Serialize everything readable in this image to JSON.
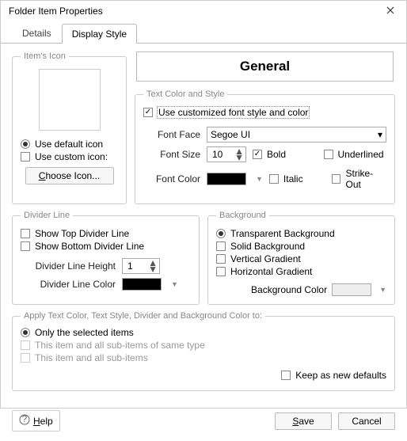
{
  "window": {
    "title": "Folder Item Properties"
  },
  "tabs": {
    "details": "Details",
    "display_style": "Display Style"
  },
  "icon_group": {
    "legend": "Item's Icon",
    "use_default": "Use default icon",
    "use_custom": "Use custom icon:",
    "choose_btn": "Choose Icon..."
  },
  "preview": {
    "text": "General"
  },
  "text_style": {
    "legend": "Text Color and Style",
    "use_custom": "Use customized font style and color",
    "font_face_lbl": "Font Face",
    "font_face_val": "Segoe UI",
    "font_size_lbl": "Font Size",
    "font_size_val": "10",
    "font_color_lbl": "Font Color",
    "bold": "Bold",
    "italic": "Italic",
    "underlined": "Underlined",
    "strikeout": "Strike-Out"
  },
  "divider": {
    "legend": "Divider Line",
    "show_top": "Show Top Divider Line",
    "show_bottom": "Show Bottom Divider Line",
    "height_lbl": "Divider Line Height",
    "height_val": "1",
    "color_lbl": "Divider Line Color"
  },
  "background": {
    "legend": "Background",
    "transparent": "Transparent Background",
    "solid": "Solid Background",
    "vgrad": "Vertical Gradient",
    "hgrad": "Horizontal Gradient",
    "color_lbl": "Background Color"
  },
  "apply": {
    "legend": "Apply Text Color, Text Style, Divider and Background Color to:",
    "selected": "Only the selected items",
    "same_type": "This item and all sub-items of same type",
    "all_sub": "This item and all sub-items",
    "keep_defaults": "Keep as new defaults"
  },
  "footer": {
    "help": "Help",
    "save": "Save",
    "cancel": "Cancel"
  },
  "colors": {
    "font": "#000000",
    "divider": "#000000",
    "background": "#eeeeee"
  }
}
